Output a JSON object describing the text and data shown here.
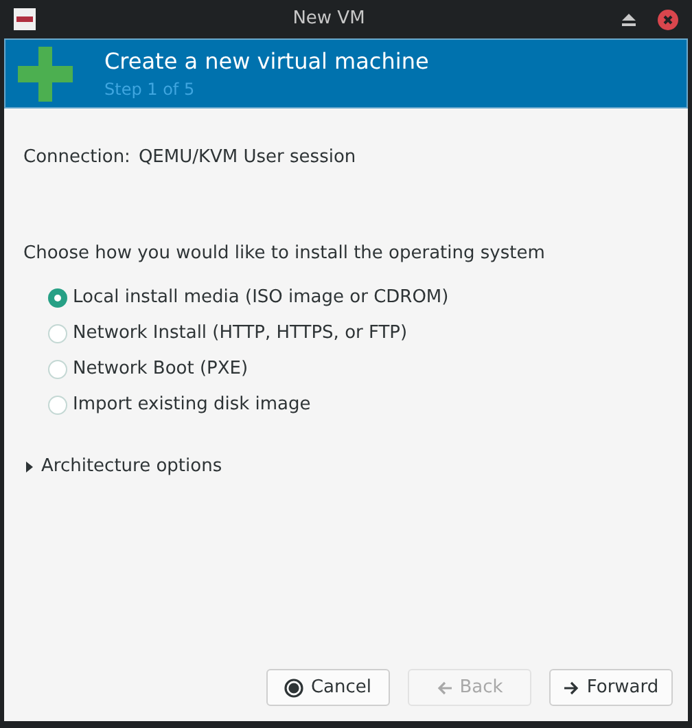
{
  "window": {
    "title": "New VM"
  },
  "header": {
    "title": "Create a new virtual machine",
    "subtitle": "Step 1 of 5"
  },
  "connection": {
    "label": "Connection:",
    "value": "QEMU/KVM User session"
  },
  "prompt": "Choose how you would like to install the operating system",
  "install_options": [
    {
      "label": "Local install media (ISO image or CDROM)",
      "selected": true
    },
    {
      "label": "Network Install (HTTP, HTTPS, or FTP)",
      "selected": false
    },
    {
      "label": "Network Boot (PXE)",
      "selected": false
    },
    {
      "label": "Import existing disk image",
      "selected": false
    }
  ],
  "architecture": {
    "label": "Architecture options",
    "expanded": false
  },
  "buttons": [
    {
      "kind": "cancel",
      "label": "Cancel",
      "disabled": false
    },
    {
      "kind": "back",
      "label": "Back",
      "disabled": true
    },
    {
      "kind": "forward",
      "label": "Forward",
      "disabled": false
    }
  ]
}
